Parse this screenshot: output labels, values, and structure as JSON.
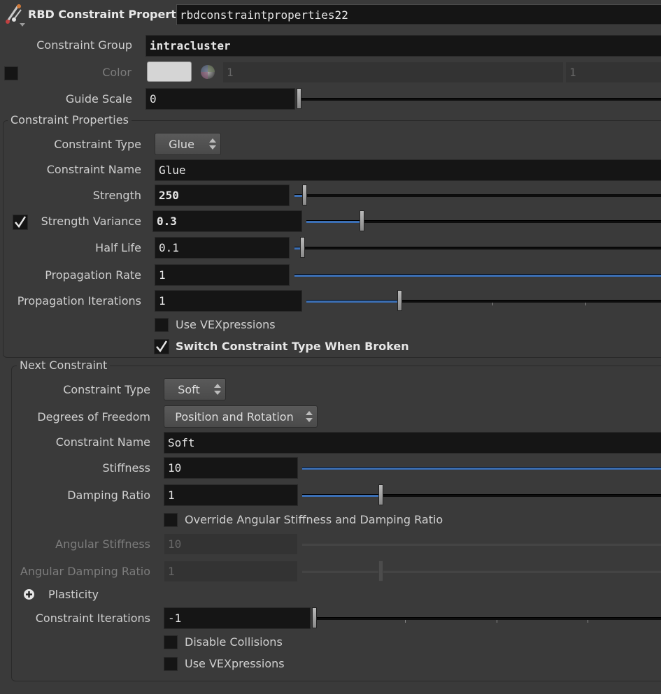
{
  "header": {
    "title": "RBD Constraint Properties",
    "node_name": "rbdconstraintproperties22",
    "icon": "rbd-node-icon"
  },
  "top": {
    "constraint_group": {
      "label": "Constraint Group",
      "value": "intracluster"
    },
    "color": {
      "label": "Color",
      "swatch": "#d5d5d5",
      "value1": "1",
      "value2": "1",
      "enabled": false
    },
    "guide_scale": {
      "label": "Guide Scale",
      "value": "0",
      "slider": 0.0
    }
  },
  "constraint_properties": {
    "title": "Constraint Properties",
    "constraint_type": {
      "label": "Constraint Type",
      "value": "Glue"
    },
    "constraint_name": {
      "label": "Constraint Name",
      "value": "Glue"
    },
    "strength": {
      "label": "Strength",
      "value": "250",
      "slider": 0.02
    },
    "strength_variance": {
      "label": "Strength Variance",
      "value": "0.3",
      "enabled": true,
      "slider": 0.3
    },
    "half_life": {
      "label": "Half Life",
      "value": "0.1",
      "slider": 0.01
    },
    "propagation_rate": {
      "label": "Propagation Rate",
      "value": "1",
      "slider": 1.0
    },
    "propagation_iterations": {
      "label": "Propagation Iterations",
      "value": "1",
      "slider": 0.26
    },
    "use_vexpressions": {
      "label": "Use VEXpressions",
      "checked": false
    },
    "switch_type": {
      "label": "Switch Constraint Type When Broken",
      "checked": true
    }
  },
  "next_constraint": {
    "title": "Next Constraint",
    "constraint_type": {
      "label": "Constraint Type",
      "value": "Soft"
    },
    "dof": {
      "label": "Degrees of Freedom",
      "value": "Position and Rotation"
    },
    "constraint_name": {
      "label": "Constraint Name",
      "value": "Soft"
    },
    "stiffness": {
      "label": "Stiffness",
      "value": "10",
      "slider": 1.0
    },
    "damping_ratio": {
      "label": "Damping Ratio",
      "value": "1",
      "slider": 0.22
    },
    "override_angular": {
      "label": "Override Angular Stiffness and Damping Ratio",
      "checked": false
    },
    "angular_stiffness": {
      "label": "Angular Stiffness",
      "value": "10",
      "enabled": false
    },
    "angular_damping": {
      "label": "Angular Damping Ratio",
      "value": "1",
      "enabled": false
    },
    "plasticity": {
      "label": "Plasticity",
      "expanded": false
    },
    "constraint_iterations": {
      "label": "Constraint Iterations",
      "value": "-1",
      "slider": 0.0
    },
    "disable_collisions": {
      "label": "Disable Collisions",
      "checked": false
    },
    "use_vexpressions": {
      "label": "Use VEXpressions",
      "checked": false
    }
  },
  "colors": {
    "accent": "#3b6fb5",
    "field_bg": "#151515",
    "panel_bg": "#3a3a3a"
  }
}
